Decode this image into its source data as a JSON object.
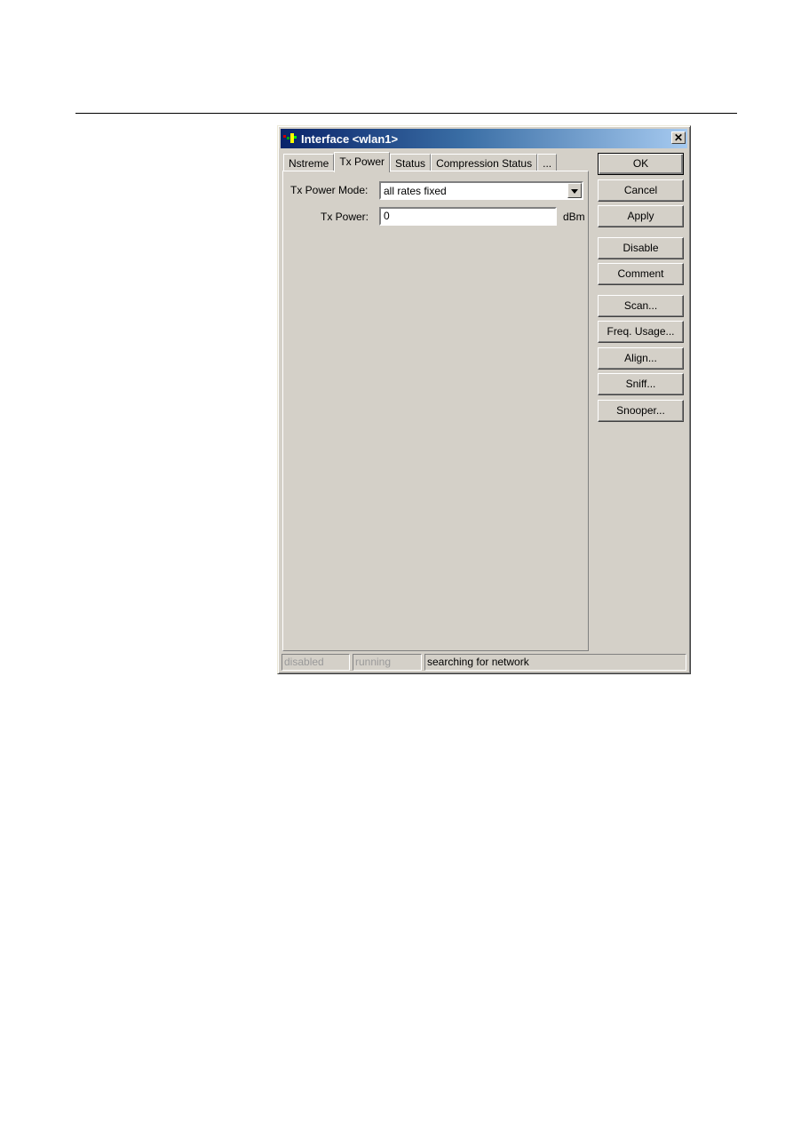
{
  "window": {
    "title": "Interface <wlan1>",
    "close_label": "✕"
  },
  "tabs": [
    {
      "label": "Nstreme",
      "active": false
    },
    {
      "label": "Tx Power",
      "active": true
    },
    {
      "label": "Status",
      "active": false
    },
    {
      "label": "Compression Status",
      "active": false
    },
    {
      "label": "...",
      "active": false
    }
  ],
  "form": {
    "tx_power_mode_label": "Tx Power Mode:",
    "tx_power_mode_value": "all rates fixed",
    "tx_power_label": "Tx Power:",
    "tx_power_value": "0",
    "tx_power_unit": "dBm"
  },
  "buttons": {
    "ok": "OK",
    "cancel": "Cancel",
    "apply": "Apply",
    "disable": "Disable",
    "comment": "Comment",
    "scan": "Scan...",
    "freq_usage": "Freq. Usage...",
    "align": "Align...",
    "sniff": "Sniff...",
    "snooper": "Snooper..."
  },
  "status": {
    "disabled": "disabled",
    "running": "running",
    "message": "searching for network"
  }
}
